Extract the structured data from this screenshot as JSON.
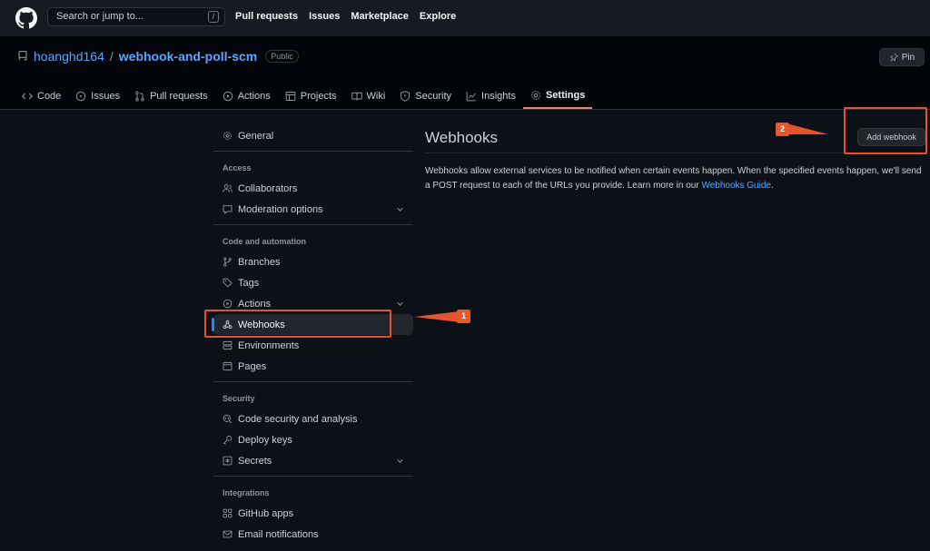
{
  "header": {
    "search_placeholder": "Search or jump to...",
    "search_shortcut": "/",
    "nav": [
      "Pull requests",
      "Issues",
      "Marketplace",
      "Explore"
    ]
  },
  "repo": {
    "owner": "hoanghd164",
    "separator": "/",
    "name": "webhook-and-poll-scm",
    "visibility": "Public",
    "pin_label": "Pin"
  },
  "tabs": [
    {
      "label": "Code",
      "icon": "code-icon"
    },
    {
      "label": "Issues",
      "icon": "issue-icon"
    },
    {
      "label": "Pull requests",
      "icon": "pull-request-icon"
    },
    {
      "label": "Actions",
      "icon": "play-icon"
    },
    {
      "label": "Projects",
      "icon": "table-icon"
    },
    {
      "label": "Wiki",
      "icon": "book-icon"
    },
    {
      "label": "Security",
      "icon": "shield-icon"
    },
    {
      "label": "Insights",
      "icon": "graph-icon"
    },
    {
      "label": "Settings",
      "icon": "gear-icon"
    }
  ],
  "sidebar": {
    "general": "General",
    "access_heading": "Access",
    "collaborators": "Collaborators",
    "moderation": "Moderation options",
    "code_heading": "Code and automation",
    "branches": "Branches",
    "tags": "Tags",
    "actions": "Actions",
    "webhooks": "Webhooks",
    "environments": "Environments",
    "pages": "Pages",
    "security_heading": "Security",
    "code_security": "Code security and analysis",
    "deploy_keys": "Deploy keys",
    "secrets": "Secrets",
    "integrations_heading": "Integrations",
    "github_apps": "GitHub apps",
    "email_notifications": "Email notifications"
  },
  "main": {
    "title": "Webhooks",
    "add_button": "Add webhook",
    "description": "Webhooks allow external services to be notified when certain events happen. When the specified events happen, we'll send a POST request to each of the URLs you provide. Learn more in our ",
    "link": "Webhooks Guide",
    "period": "."
  },
  "annotations": {
    "marker1": "1",
    "marker2": "2"
  },
  "colors": {
    "accent": "#2f81f7",
    "link": "#58a6ff",
    "tab_underline": "#f78166",
    "annotation": "#e5532d"
  }
}
